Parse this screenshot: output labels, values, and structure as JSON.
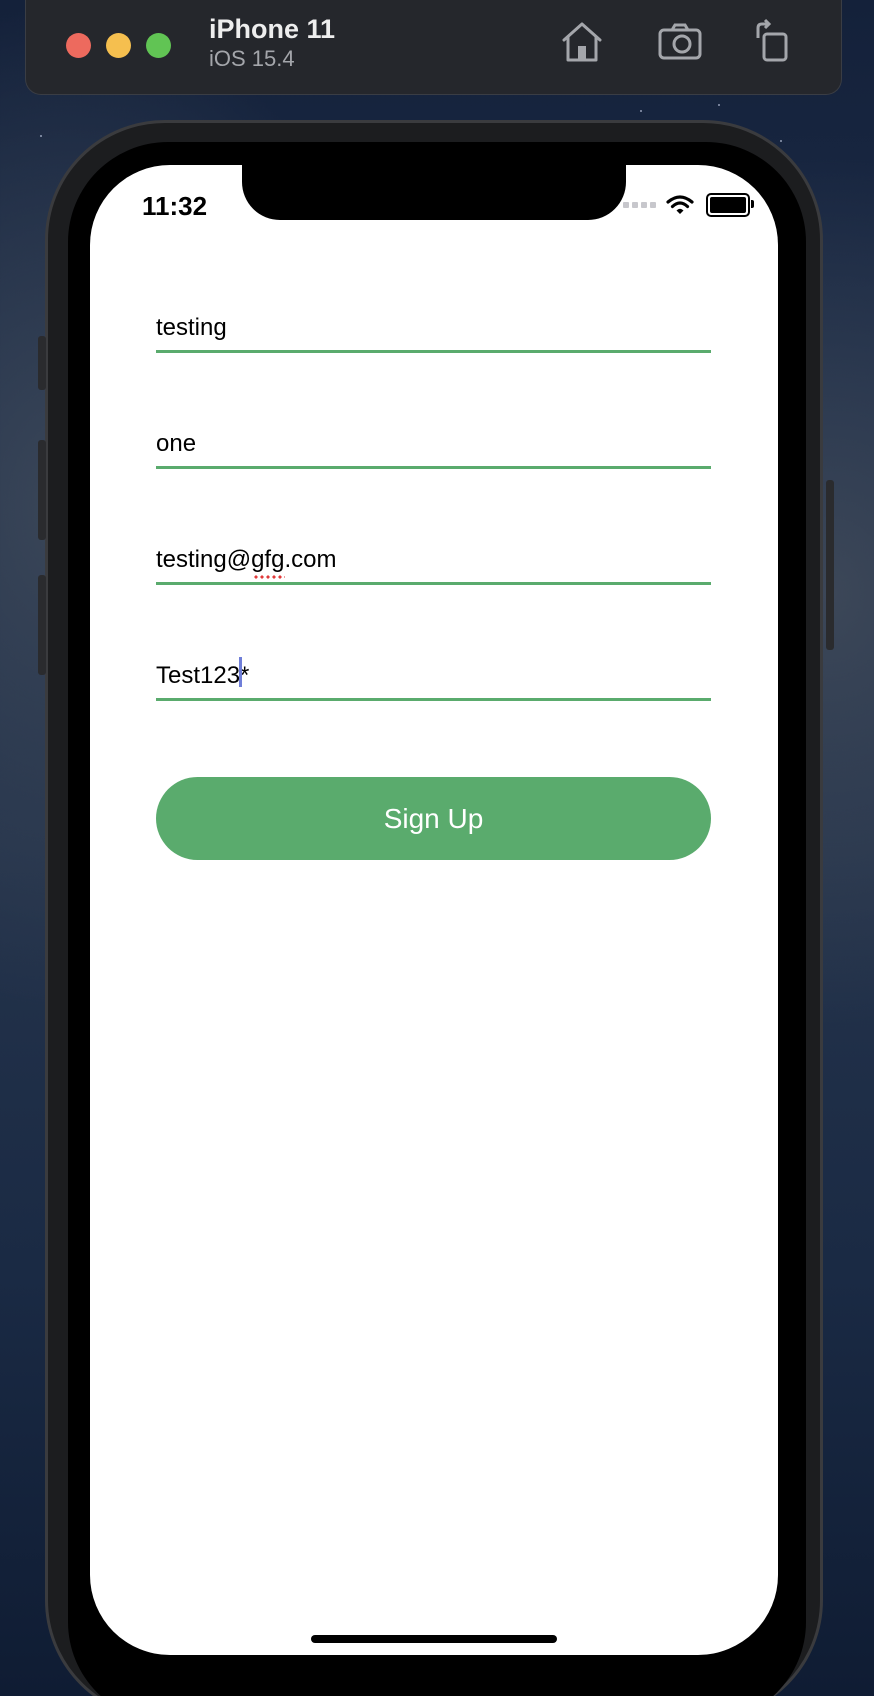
{
  "simulator": {
    "device_name": "iPhone 11",
    "os_version": "iOS 15.4",
    "icons": [
      "home-icon",
      "screenshot-icon",
      "rotate-icon"
    ]
  },
  "status_bar": {
    "time": "11:32"
  },
  "form": {
    "first_name": "testing",
    "last_name": "one",
    "email": "testing@gfg.com",
    "password": "Test123*",
    "signup_label": "Sign Up"
  },
  "colors": {
    "accent": "#5aab6d",
    "screen_bg": "#ffffff"
  }
}
